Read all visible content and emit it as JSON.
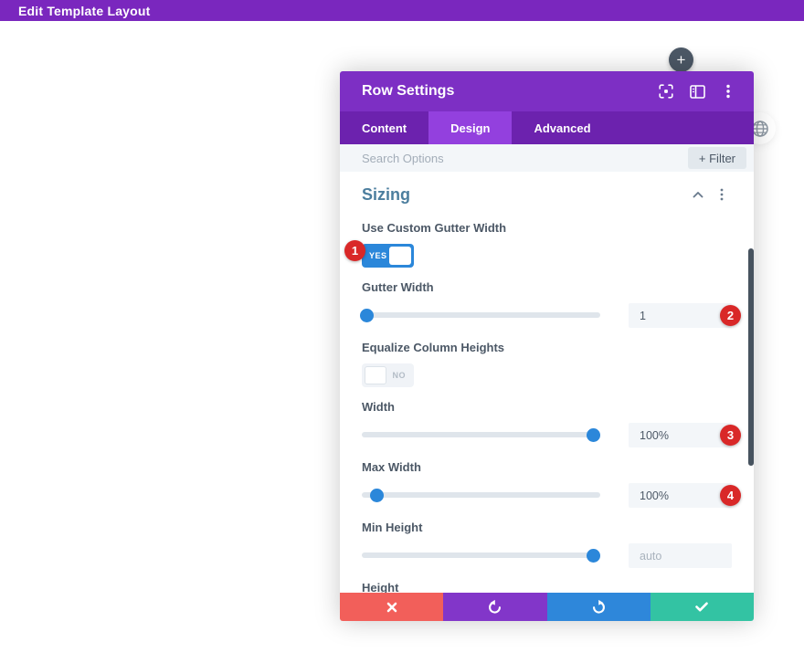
{
  "topbar": {
    "title": "Edit Template Layout"
  },
  "floating": {
    "add_label": "+"
  },
  "modal": {
    "title": "Row Settings",
    "tabs": [
      {
        "label": "Content",
        "active": false
      },
      {
        "label": "Design",
        "active": true
      },
      {
        "label": "Advanced",
        "active": false
      }
    ],
    "search": {
      "placeholder": "Search Options",
      "filter_label": "+ Filter"
    },
    "section": {
      "title": "Sizing"
    },
    "fields": [
      {
        "type": "toggle",
        "label": "Use Custom Gutter Width",
        "value": "YES",
        "state": "on",
        "badge": "1"
      },
      {
        "type": "slider",
        "label": "Gutter Width",
        "value": "1",
        "pos": 2,
        "badge": "2"
      },
      {
        "type": "toggle",
        "label": "Equalize Column Heights",
        "value": "NO",
        "state": "off"
      },
      {
        "type": "slider",
        "label": "Width",
        "value": "100%",
        "pos": 97,
        "badge": "3"
      },
      {
        "type": "slider",
        "label": "Max Width",
        "value": "100%",
        "pos": 6,
        "badge": "4"
      },
      {
        "type": "slider",
        "label": "Min Height",
        "placeholder": "auto",
        "pos": 97
      },
      {
        "type": "label",
        "label": "Height"
      }
    ]
  },
  "colors": {
    "purple_header": "#7d2fc4",
    "purple_tabbar": "#6c22ae",
    "purple_tab_active": "#9340de",
    "accent_blue": "#2b87da",
    "badge_red": "#d92828",
    "footer_discard": "#f25f5a",
    "footer_undo": "#8236c9",
    "footer_redo": "#2e87da",
    "footer_save": "#33c3a3",
    "label_text": "#4c5866",
    "section_title": "#4c7e9e"
  }
}
